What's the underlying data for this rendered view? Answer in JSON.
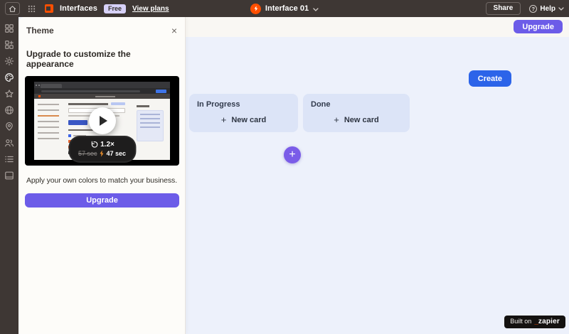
{
  "topbar": {
    "product": "Interfaces",
    "plan_badge": "Free",
    "view_plans": "View plans",
    "project": "Interface 01",
    "share": "Share",
    "help": "Help"
  },
  "sidebar": {
    "icons": [
      "blocks",
      "add-block",
      "settings",
      "theme",
      "star",
      "globe",
      "location",
      "users",
      "list",
      "footer-panel"
    ],
    "active_icon": "theme"
  },
  "theme_panel": {
    "title": "Theme",
    "heading": "Upgrade to customize the appearance",
    "video": {
      "speed": "1.2×",
      "duration_original": "57 sec",
      "duration_fast": "47 sec"
    },
    "description": "Apply your own colors to match your business.",
    "upgrade_label": "Upgrade"
  },
  "main": {
    "upgrade_label": "Upgrade",
    "create_label": "Create",
    "columns": [
      {
        "title": "In Progress",
        "action": "New card"
      },
      {
        "title": "Done",
        "action": "New card"
      }
    ],
    "footer_badge": {
      "prefix": "Built on",
      "underscore": "_",
      "brand": "zapier"
    }
  },
  "icons": {
    "close": "×",
    "plus": "+",
    "question": "?"
  },
  "colors": {
    "topbar": "#3e3734",
    "accent_purple": "#6c5ce8",
    "accent_blue": "#2c64e9",
    "brand_orange": "#ff4f00",
    "canvas": "#edf1fb",
    "column_card": "#dce4f7"
  }
}
